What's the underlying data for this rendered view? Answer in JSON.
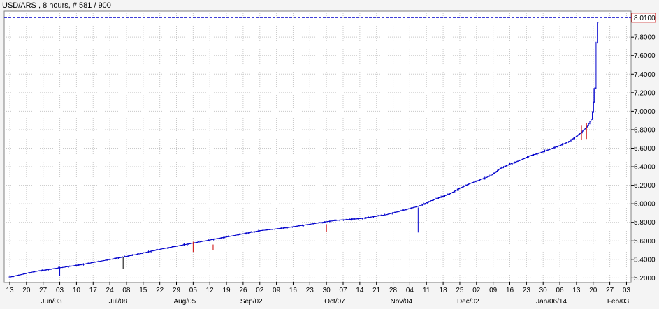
{
  "header": {
    "title": "USD/ARS , 8 hours, # 581 / 900"
  },
  "chart_data": {
    "type": "ohlc",
    "title": "USD/ARS , 8 hours, # 581 / 900",
    "xlabel": "",
    "ylabel": "",
    "ylim": [
      5.15,
      8.08
    ],
    "grid": true,
    "current_value_label": "8.0100",
    "current_value": 8.01,
    "y_ticks": [
      {
        "value": 5.2,
        "label": "5.2000"
      },
      {
        "value": 5.4,
        "label": "5.4000"
      },
      {
        "value": 5.6,
        "label": "5.6000"
      },
      {
        "value": 5.8,
        "label": "5.8000"
      },
      {
        "value": 6.0,
        "label": "6.0000"
      },
      {
        "value": 6.2,
        "label": "6.2000"
      },
      {
        "value": 6.4,
        "label": "6.4000"
      },
      {
        "value": 6.6,
        "label": "6.6000"
      },
      {
        "value": 6.8,
        "label": "6.8000"
      },
      {
        "value": 7.0,
        "label": "7.0000"
      },
      {
        "value": 7.2,
        "label": "7.2000"
      },
      {
        "value": 7.4,
        "label": "7.4000"
      },
      {
        "value": 7.6,
        "label": "7.6000"
      },
      {
        "value": 7.8,
        "label": "7.8000"
      }
    ],
    "x_ticks": [
      "13",
      "20",
      "27",
      "03",
      "10",
      "17",
      "24",
      "08",
      "15",
      "22",
      "29",
      "05",
      "12",
      "19",
      "26",
      "02",
      "09",
      "16",
      "23",
      "30",
      "07",
      "14",
      "21",
      "28",
      "04",
      "11",
      "18",
      "25",
      "02",
      "09",
      "16",
      "23",
      "30",
      "06",
      "13",
      "20",
      "27",
      "03"
    ],
    "month_labels": [
      {
        "label": "Jun/03",
        "tick": 3
      },
      {
        "label": "Jul/08",
        "tick": 7
      },
      {
        "label": "Aug/05",
        "tick": 11
      },
      {
        "label": "Sep/02",
        "tick": 15
      },
      {
        "label": "Oct/07",
        "tick": 20
      },
      {
        "label": "Nov/04",
        "tick": 24
      },
      {
        "label": "Dec/02",
        "tick": 28
      },
      {
        "label": "Jan/06/14",
        "tick": 33
      },
      {
        "label": "Feb/03",
        "tick": 37
      }
    ],
    "series": [
      {
        "x": [
          0,
          1.5,
          3,
          4.5,
          6,
          7.5,
          9,
          10.5,
          12,
          13.5,
          15,
          16.5,
          18,
          19.5,
          21,
          22.5,
          24,
          24.6,
          25.2,
          25.8,
          26.4,
          27,
          27.6,
          28.2,
          28.8,
          29.4,
          30,
          30.6,
          31.2,
          31.8,
          32.4,
          33,
          33.6,
          33.9,
          34.2,
          34.5,
          34.7,
          34.9,
          35.0,
          35.1,
          35.2,
          35.3
        ],
        "values": [
          5.21,
          5.27,
          5.31,
          5.35,
          5.4,
          5.45,
          5.51,
          5.56,
          5.61,
          5.66,
          5.71,
          5.74,
          5.78,
          5.82,
          5.84,
          5.88,
          5.95,
          5.98,
          6.03,
          6.07,
          6.11,
          6.17,
          6.22,
          6.26,
          6.3,
          6.38,
          6.43,
          6.47,
          6.52,
          6.55,
          6.59,
          6.63,
          6.68,
          6.72,
          6.76,
          6.81,
          6.86,
          6.92,
          7.05,
          7.25,
          7.9,
          8.01
        ]
      }
    ],
    "spikes": [
      {
        "x": 11.0,
        "low": 5.48,
        "high": 5.59,
        "color": "#cc0000"
      },
      {
        "x": 12.2,
        "low": 5.5,
        "high": 5.56,
        "color": "#cc0000"
      },
      {
        "x": 24.5,
        "low": 5.69,
        "high": 5.96,
        "color": "#0000cc"
      },
      {
        "x": 19.0,
        "low": 5.7,
        "high": 5.78,
        "color": "#cc0000"
      },
      {
        "x": 6.8,
        "low": 5.3,
        "high": 5.42,
        "color": "#000000"
      },
      {
        "x": 3.0,
        "low": 5.22,
        "high": 5.32,
        "color": "#0000cc"
      },
      {
        "x": 34.3,
        "low": 6.69,
        "high": 6.85,
        "color": "#cc0000"
      },
      {
        "x": 34.6,
        "low": 6.7,
        "high": 6.87,
        "color": "#cc0000"
      },
      {
        "x": 35.05,
        "low": 7.1,
        "high": 7.25,
        "color": "#0000cc"
      }
    ],
    "colors": {
      "up": "#0000cc",
      "down": "#cc0000",
      "grid": "#c8c8c8",
      "price_line": "#0000cc",
      "label_box": "#cc0000"
    }
  }
}
